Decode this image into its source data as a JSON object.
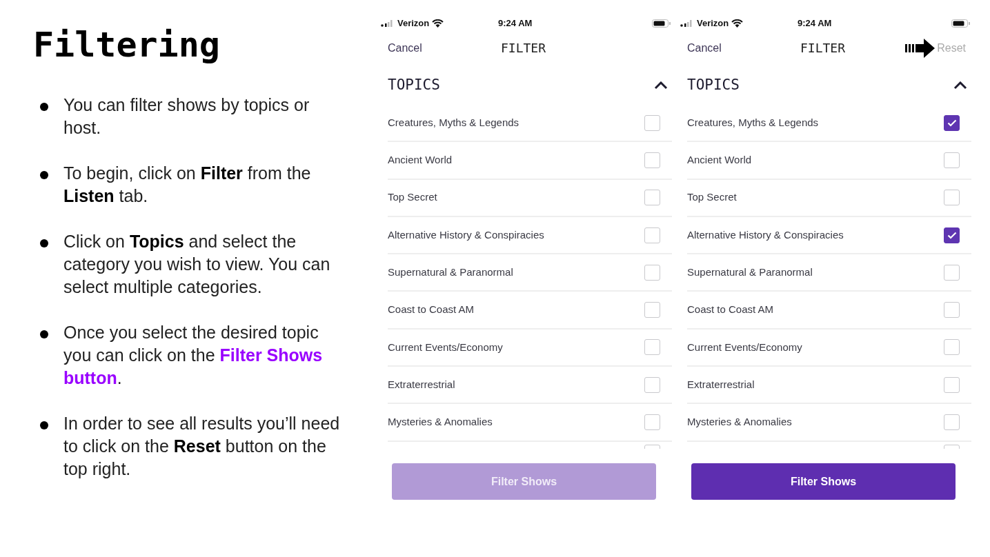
{
  "slide": {
    "title": "Filtering",
    "bullets": [
      [
        {
          "text": "You can filter shows by topics or host."
        }
      ],
      [
        {
          "text": "To begin, click on "
        },
        {
          "text": "Filter",
          "bold": true
        },
        {
          "text": " from the "
        },
        {
          "text": "Listen",
          "bold": true
        },
        {
          "text": " tab."
        }
      ],
      [
        {
          "text": "Click on "
        },
        {
          "text": "Topics",
          "bold": true
        },
        {
          "text": " and select the category you wish to view. You can select multiple categories."
        }
      ],
      [
        {
          "text": "Once you select the desired topic you can click on the "
        },
        {
          "text": "Filter Shows button",
          "bold": true,
          "accent": true
        },
        {
          "text": "."
        }
      ],
      [
        {
          "text": "In order to see all results you’ll need to click on the "
        },
        {
          "text": "Reset",
          "bold": true
        },
        {
          "text": " button on the top right."
        }
      ]
    ]
  },
  "phones": [
    {
      "status_bar": {
        "carrier": "Verizon",
        "time": "9:24 AM"
      },
      "nav": {
        "cancel": "Cancel",
        "title": "FILTER"
      },
      "section": {
        "title": "TOPICS",
        "expanded": true
      },
      "topics": [
        {
          "label": "Creatures, Myths & Legends",
          "checked": false
        },
        {
          "label": "Ancient World",
          "checked": false
        },
        {
          "label": "Top Secret",
          "checked": false
        },
        {
          "label": "Alternative History & Conspiracies",
          "checked": false
        },
        {
          "label": "Supernatural & Paranormal",
          "checked": false
        },
        {
          "label": "Coast to Coast AM",
          "checked": false
        },
        {
          "label": "Current Events/Economy",
          "checked": false
        },
        {
          "label": "Extraterrestrial",
          "checked": false
        },
        {
          "label": "Mysteries & Anomalies",
          "checked": false
        }
      ],
      "partial_row": {
        "checked": false
      },
      "button": {
        "label": "Filter Shows",
        "disabled": true
      }
    },
    {
      "status_bar": {
        "carrier": "Verizon",
        "time": "9:24 AM"
      },
      "nav": {
        "cancel": "Cancel",
        "title": "FILTER",
        "reset": "Reset",
        "pointer": true
      },
      "section": {
        "title": "TOPICS",
        "expanded": true
      },
      "topics": [
        {
          "label": "Creatures, Myths & Legends",
          "checked": true
        },
        {
          "label": "Ancient World",
          "checked": false
        },
        {
          "label": "Top Secret",
          "checked": false
        },
        {
          "label": "Alternative History & Conspiracies",
          "checked": true
        },
        {
          "label": "Supernatural & Paranormal",
          "checked": false
        },
        {
          "label": "Coast to Coast AM",
          "checked": false
        },
        {
          "label": "Current Events/Economy",
          "checked": false
        },
        {
          "label": "Extraterrestrial",
          "checked": false
        },
        {
          "label": "Mysteries & Anomalies",
          "checked": false
        }
      ],
      "partial_row": {
        "checked": false
      },
      "button": {
        "label": "Filter Shows",
        "disabled": false
      }
    }
  ]
}
